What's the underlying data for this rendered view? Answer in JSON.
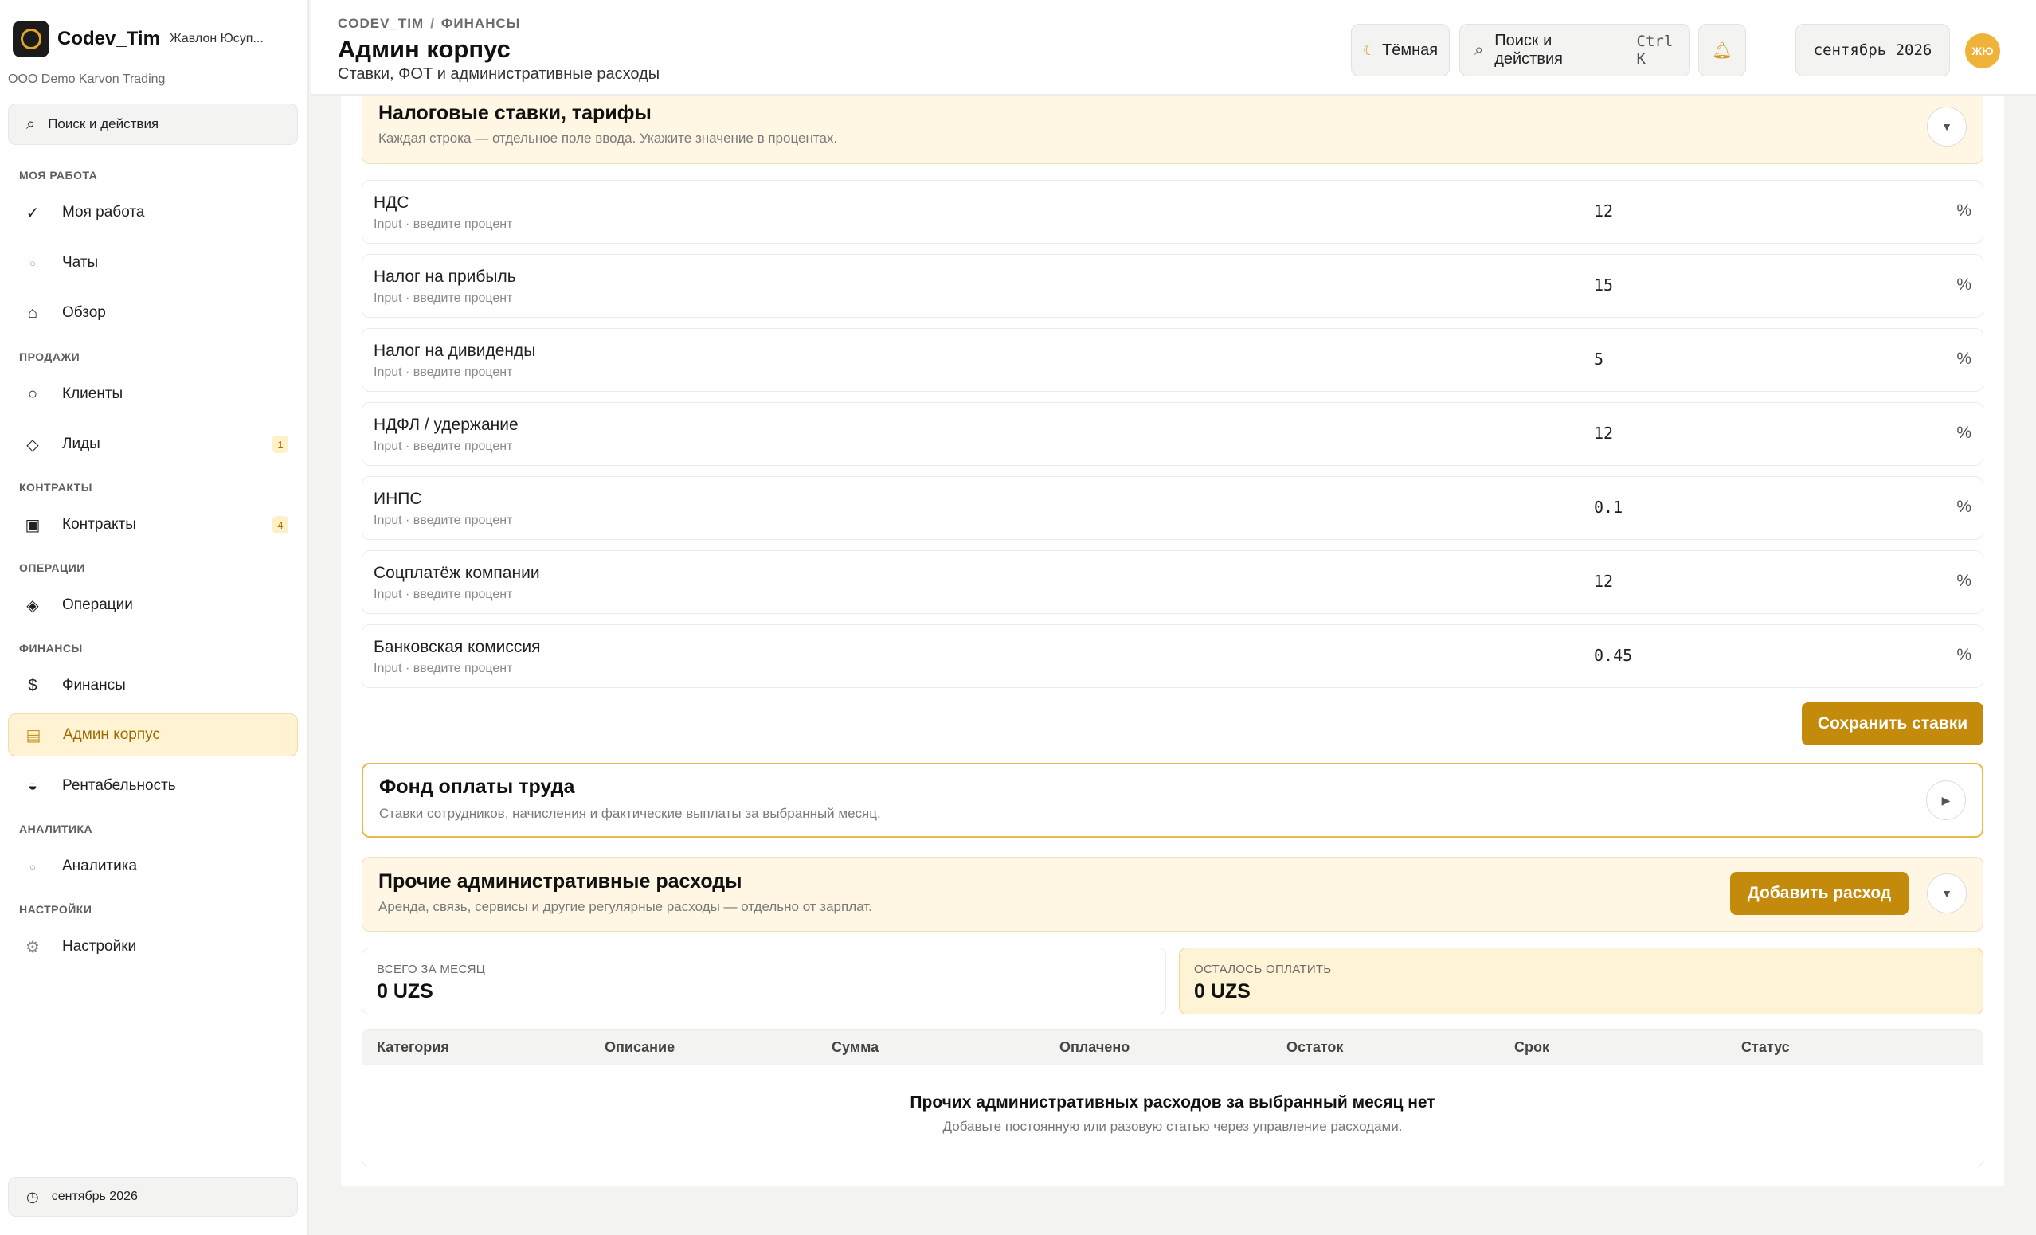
{
  "sidebar": {
    "brand_name": "Codev_Tim",
    "user_name": "Жавлон Юсуп...",
    "org": "OOO Demo Karvon Trading",
    "search_label": "Поиск и действия",
    "sections": {
      "my_work": "МОЯ РАБОТА",
      "sales": "ПРОДАЖИ",
      "contracts": "КОНТРАКТЫ",
      "operations": "ОПЕРАЦИИ",
      "finance": "ФИНАНСЫ",
      "analytics": "АНАЛИТИКА",
      "settings": "НАСТРОЙКИ"
    },
    "items": {
      "my_work": "Моя работа",
      "chats": "Чаты",
      "overview": "Обзор",
      "clients": "Клиенты",
      "leads": "Лиды",
      "leads_badge": "1",
      "contracts": "Контракты",
      "contracts_badge": "4",
      "operations": "Операции",
      "finance": "Финансы",
      "admin_corp": "Админ корпус",
      "profitability": "Рентабельность",
      "analytics": "Аналитика",
      "settings": "Настройки"
    },
    "month": "сентябрь 2026"
  },
  "header": {
    "crumb_root": "CODEV_TIM",
    "crumb_section": "ФИНАНСЫ",
    "title": "Админ корпус",
    "subtitle": "Ставки, ФОТ и административные расходы",
    "theme_label": "Тёмная",
    "search_label": "Поиск и действия",
    "search_shortcut": "Ctrl K",
    "month": "сентябрь 2026",
    "avatar_initials": "ЖЮ"
  },
  "taxes": {
    "title": "Налоговые ставки, тарифы",
    "desc": "Каждая строка — отдельное поле ввода. Укажите значение в процентах.",
    "hint": "Input · введите процент",
    "unit": "%",
    "rows": [
      {
        "label": "НДС",
        "value": "12"
      },
      {
        "label": "Налог на прибыль",
        "value": "15"
      },
      {
        "label": "Налог на дивиденды",
        "value": "5"
      },
      {
        "label": "НДФЛ / удержание",
        "value": "12"
      },
      {
        "label": "ИНПС",
        "value": "0.1"
      },
      {
        "label": "Соцплатёж компании",
        "value": "12"
      },
      {
        "label": "Банковская комиссия",
        "value": "0.45"
      }
    ],
    "save_label": "Сохранить ставки"
  },
  "payroll": {
    "title": "Фонд оплаты труда",
    "desc": "Ставки сотрудников, начисления и фактические выплаты за выбранный месяц."
  },
  "other_expenses": {
    "title": "Прочие административные расходы",
    "desc": "Аренда, связь, сервисы и другие регулярные расходы — отдельно от зарплат.",
    "add_label": "Добавить расход",
    "total_label": "ВСЕГО ЗА МЕСЯЦ",
    "total_value": "0 UZS",
    "remaining_label": "ОСТАЛОСЬ ОПЛАТИТЬ",
    "remaining_value": "0 UZS",
    "columns": [
      "Категория",
      "Описание",
      "Сумма",
      "Оплачено",
      "Остаток",
      "Срок",
      "Статус"
    ],
    "empty_title": "Прочих административных расходов за выбранный месяц нет",
    "empty_desc": "Добавьте постоянную или разовую статью через управление расходами."
  },
  "colors": {
    "accent": "#c48a0c",
    "accent_soft": "#fff6e3",
    "active_nav": "#fff3d4"
  },
  "icons": {
    "search": "search-icon",
    "theme": "moon-icon",
    "bell": "bell-icon",
    "clock": "clock-icon",
    "chevron_down": "chevron-down-icon",
    "chevron_right": "chevron-right-icon"
  }
}
